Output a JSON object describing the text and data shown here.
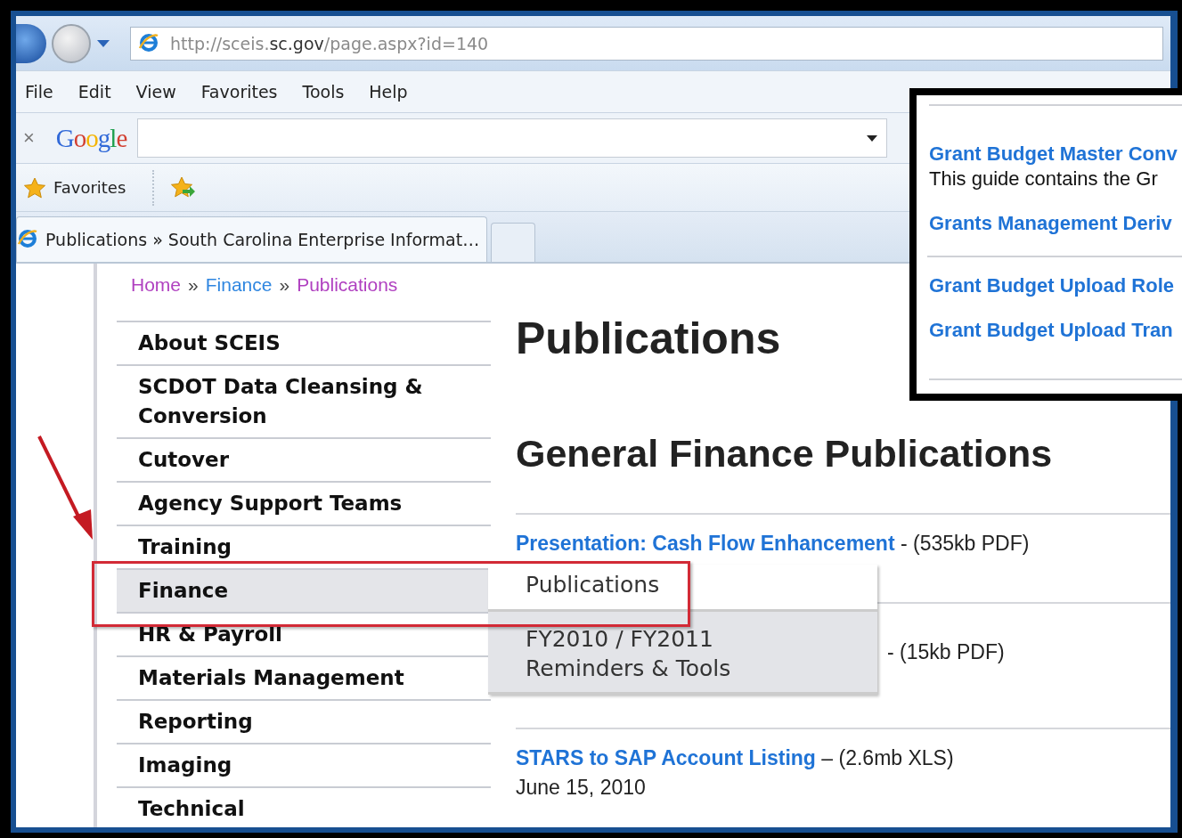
{
  "address_bar": {
    "url": "http://sceis.**sc.gov**/page.aspx?id=140"
  },
  "menu": [
    "File",
    "Edit",
    "View",
    "Favorites",
    "Tools",
    "Help"
  ],
  "google_bar": {
    "close": "×",
    "logo": "Google"
  },
  "favorites_bar": {
    "label": "Favorites"
  },
  "tabs": [
    {
      "label": "Publications » South Carolina Enterprise Informat…",
      "selected": true
    }
  ],
  "breadcrumb": [
    {
      "label": "Home",
      "visited": true
    },
    {
      "label": "»",
      "kind": "separator"
    },
    {
      "label": "Finance",
      "visited": false
    },
    {
      "label": "»",
      "kind": "separator"
    },
    {
      "label": "Publications",
      "visited": true
    }
  ],
  "nav": [
    {
      "label": "About SCEIS",
      "selected": false
    },
    {
      "label": "SCDOT Data Cleansing & Conversion",
      "selected": false
    },
    {
      "label": "Cutover",
      "selected": false
    },
    {
      "label": "Agency Support Teams",
      "selected": false
    },
    {
      "label": "Training",
      "selected": false
    },
    {
      "label": "Finance",
      "selected": true
    },
    {
      "label": "HR & Payroll",
      "selected": false
    },
    {
      "label": "Materials Management",
      "selected": false
    },
    {
      "label": "Reporting",
      "selected": false
    },
    {
      "label": "Imaging",
      "selected": false
    },
    {
      "label": "Technical",
      "selected": false
    }
  ],
  "flyout": [
    {
      "label": "Publications",
      "selected": false
    },
    {
      "label": "FY2010 / FY2011\nReminders & Tools",
      "selected": true
    }
  ],
  "page_title": "Publications",
  "section_title": "General Finance Publications",
  "publications": [
    {
      "link": "Presentation: Cash Flow Enhancement",
      "info": "- (535kb PDF)"
    },
    {
      "info": "- (15kb PDF)"
    },
    {
      "link": "STARS to SAP Account Listing",
      "info": "– (2.6mb XLS)",
      "date": "June 15, 2010"
    }
  ],
  "inset": {
    "items": [
      {
        "kind": "link",
        "text": "Grant Budget Master Conv"
      },
      {
        "kind": "description",
        "text": "This guide contains the Gr"
      },
      {
        "kind": "link",
        "text": "Grants Management Deriv"
      },
      {
        "kind": "divider"
      },
      {
        "kind": "link",
        "text": "Grant Budget Upload Role"
      },
      {
        "kind": "link",
        "text": "Grant Budget Upload Tran"
      }
    ]
  }
}
